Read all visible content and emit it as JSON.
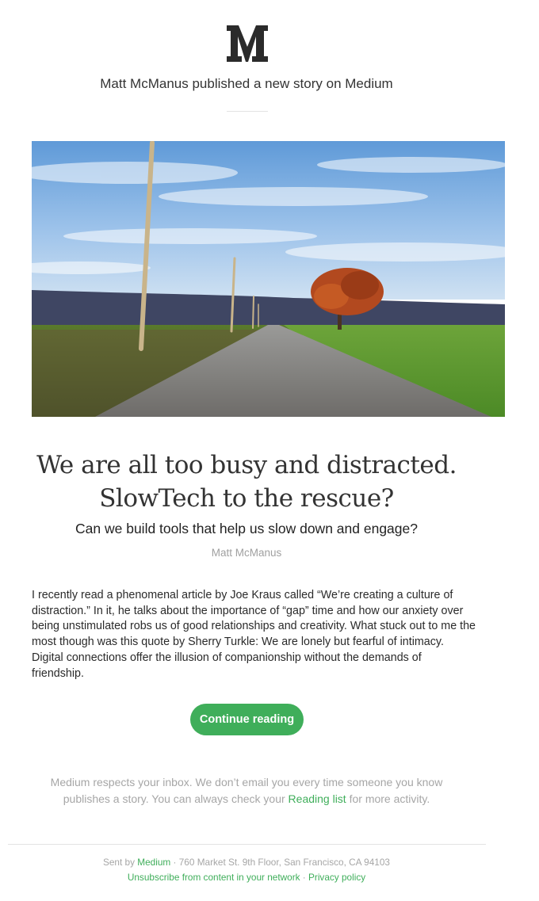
{
  "header": {
    "logo_text": "M",
    "headline": "Matt McManus published a new story on Medium"
  },
  "story": {
    "title_line1": "We are all too busy and distracted.",
    "title_line2": "SlowTech to the rescue?",
    "subtitle": "Can we build tools that help us slow down and engage?",
    "author": "Matt McManus",
    "excerpt": "I recently read a phenomenal article by Joe Kraus called “We’re creating a culture of distraction.” In it, he talks about the importance of “gap” time and how our anxiety over being unstimulated robs us of good relationships and creativity. What stuck out to me the most though was this quote by Sherry Turkle: We are lonely but fearful of intimacy. Digital connections offer the illusion of companionship without the demands of friendship.",
    "cta_label": "Continue reading"
  },
  "note": {
    "text_before": "Medium respects your inbox. We don’t email you every time someone you know publishes a story. You can always check your ",
    "link_label": "Reading list",
    "text_after": " for more activity."
  },
  "footer": {
    "sent_by": "Sent by ",
    "sender_link": "Medium",
    "address": " · 760 Market St. 9th Floor, San Francisco, CA 94103",
    "unsubscribe_link": "Unsubscribe from content in your network",
    "separator": " · ",
    "privacy_link": "Privacy policy"
  },
  "colors": {
    "accent": "#3fae5a",
    "muted_text": "#a6a6a6",
    "body_text": "#2a2a2a"
  }
}
